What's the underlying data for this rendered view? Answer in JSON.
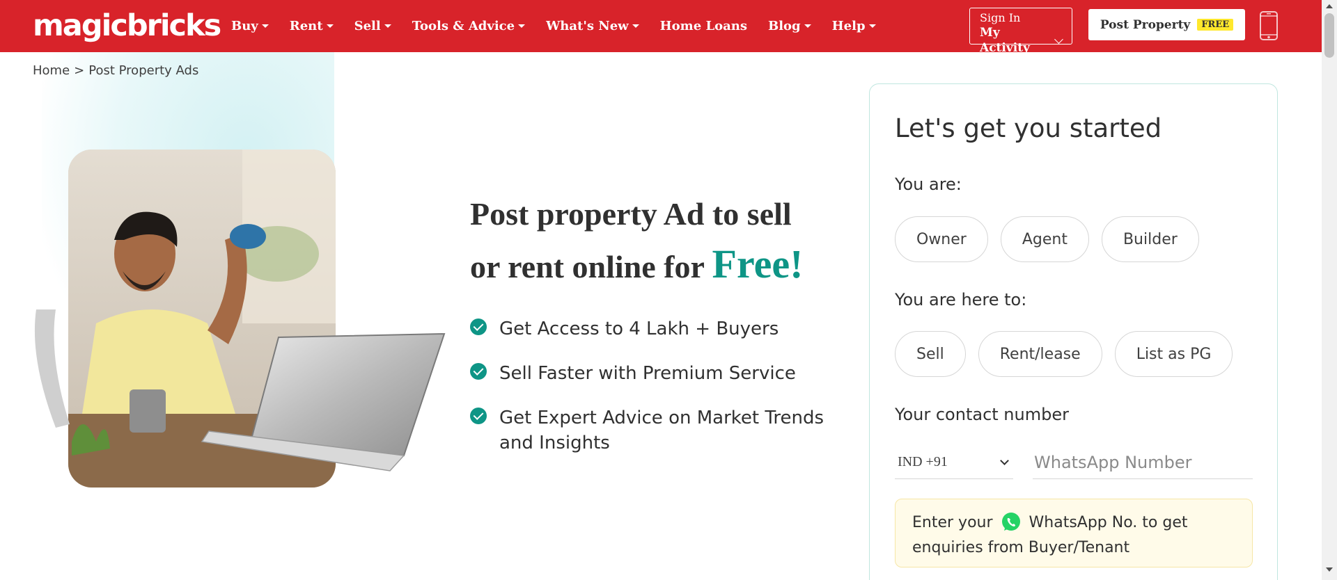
{
  "header": {
    "logo": "magicbricks",
    "nav": [
      {
        "label": "Buy",
        "dropdown": true
      },
      {
        "label": "Rent",
        "dropdown": true
      },
      {
        "label": "Sell",
        "dropdown": true
      },
      {
        "label": "Tools & Advice",
        "dropdown": true
      },
      {
        "label": "What's New",
        "dropdown": true
      },
      {
        "label": "Home Loans",
        "dropdown": false
      },
      {
        "label": "Blog",
        "dropdown": true
      },
      {
        "label": "Help",
        "dropdown": true
      }
    ],
    "signin_line1": "Sign In",
    "signin_line2": "My Activity",
    "post_property_label": "Post Property",
    "free_badge": "FREE",
    "phone_icon": "mobile-phone-icon",
    "brand_color": "#d8232a"
  },
  "breadcrumb": {
    "home": "Home",
    "separator": ">",
    "current": "Post Property Ads"
  },
  "hero": {
    "headline_part1": "Post property Ad to sell",
    "headline_part2": "or rent online for",
    "headline_highlight": "Free!",
    "accent_color": "#0e9586",
    "benefits": [
      "Get Access to 4 Lakh + Buyers",
      "Sell Faster with Premium Service",
      "Get Expert Advice on Market Trends and Insights"
    ]
  },
  "form": {
    "title": "Let's get you started",
    "you_are_label": "You are:",
    "you_are_options": [
      "Owner",
      "Agent",
      "Builder"
    ],
    "here_to_label": "You are here to:",
    "here_to_options": [
      "Sell",
      "Rent/lease",
      "List as PG"
    ],
    "contact_label": "Your contact number",
    "country_code": "IND +91",
    "phone_placeholder": "WhatsApp Number",
    "whatsapp_note_prefix": "Enter your",
    "whatsapp_note_suffix": "WhatsApp No. to get enquiries from Buyer/Tenant"
  }
}
